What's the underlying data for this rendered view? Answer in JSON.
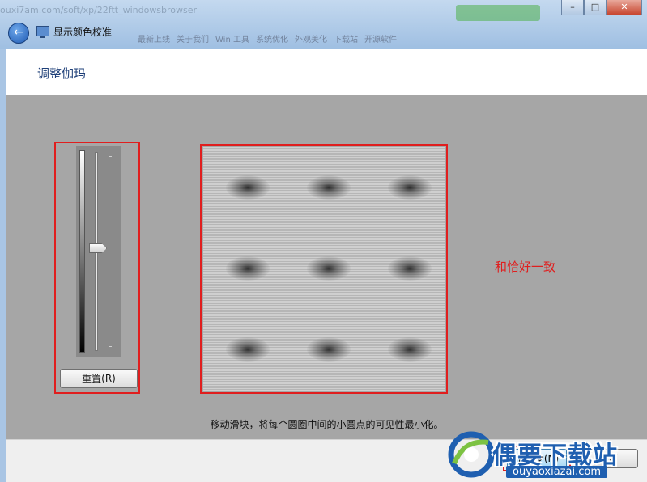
{
  "browser_bg": {
    "url": "ouxi7am.com/soft/xp/22ftt_windowsbrowser",
    "favorites": [
      "最新上线",
      "关于我们",
      "Win 工具",
      "系统优化",
      "外观美化",
      "下载站",
      "开源软件"
    ]
  },
  "window": {
    "title": "显示颜色校准",
    "minimize": "–",
    "maximize": "□",
    "close": "✕",
    "back": "←"
  },
  "page": {
    "heading": "调整伽玛",
    "reset_label": "重置(R)",
    "annotation": "和恰好一致",
    "instruction": "移动滑块，将每个圆圈中间的小圆点的可见性最小化。"
  },
  "footer": {
    "next_label": "下一步(N)",
    "cancel_label": "取消"
  },
  "gamma_slider": {
    "value_fraction": 0.5
  },
  "watermark": {
    "title": "偶要下载站",
    "url": "ouyaoxiazai.com"
  },
  "colors": {
    "annotation_red": "#e01e1e",
    "heading_blue": "#1e3f78",
    "watermark_blue": "#1f5fb0"
  }
}
